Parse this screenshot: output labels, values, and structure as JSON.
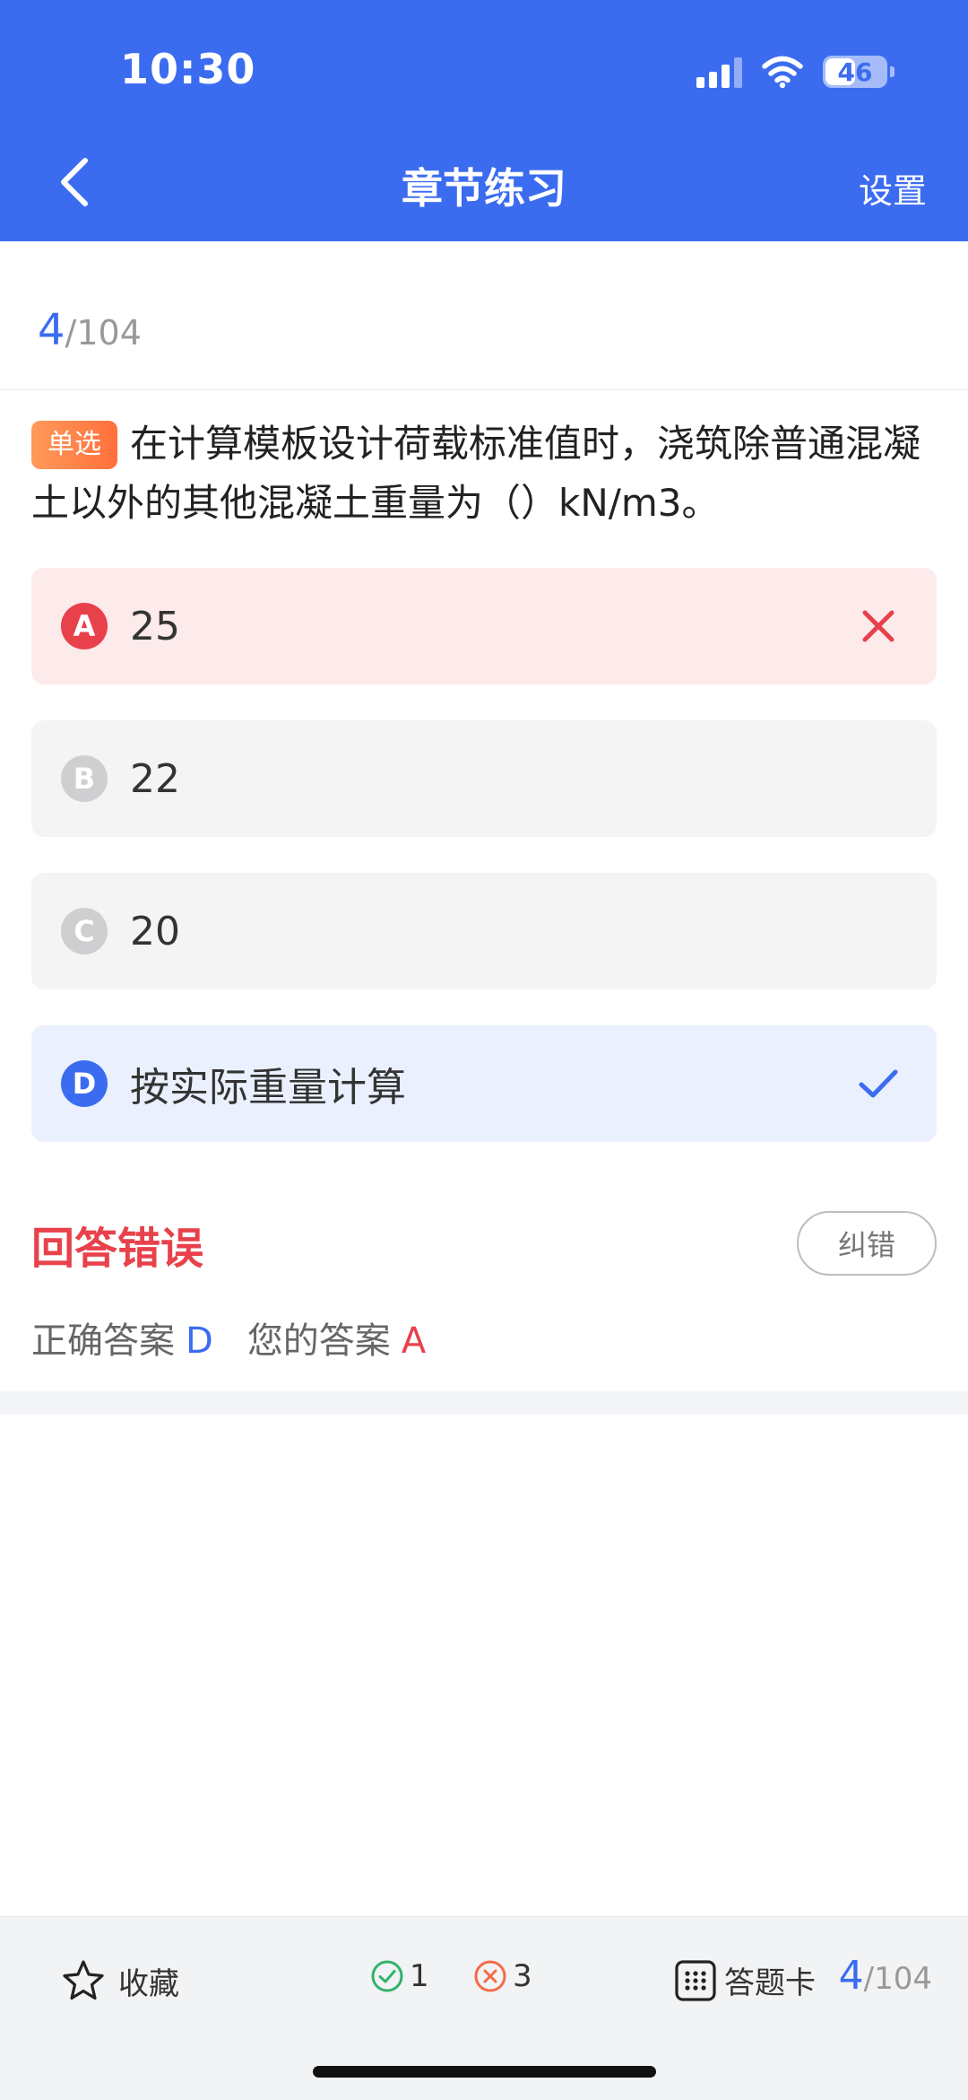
{
  "status": {
    "time": "10:30",
    "battery": "46"
  },
  "nav": {
    "title": "章节练习",
    "settings": "设置"
  },
  "progress": {
    "current": "4",
    "total": "/104"
  },
  "question": {
    "type_tag": "单选",
    "text": "在计算模板设计荷载标准值时，浇筑除普通混凝土以外的其他混凝土重量为（）kN/m3。"
  },
  "options": [
    {
      "letter": "A",
      "text": "25",
      "state": "wrong"
    },
    {
      "letter": "B",
      "text": "22",
      "state": "neutral"
    },
    {
      "letter": "C",
      "text": "20",
      "state": "neutral"
    },
    {
      "letter": "D",
      "text": "按实际重量计算",
      "state": "correct"
    }
  ],
  "result": {
    "title": "回答错误",
    "report_button": "纠错",
    "correct_label": "正确答案",
    "correct_value": "D",
    "yours_label": "您的答案",
    "yours_value": "A"
  },
  "bottom": {
    "favorite": "收藏",
    "right_count": "1",
    "wrong_count": "3",
    "answer_card": "答题卡",
    "current": "4",
    "total": "/104"
  },
  "colors": {
    "accent": "#3b6cf0",
    "error": "#e8414b",
    "success": "#2fb36b",
    "tag": "#ff7a45"
  }
}
